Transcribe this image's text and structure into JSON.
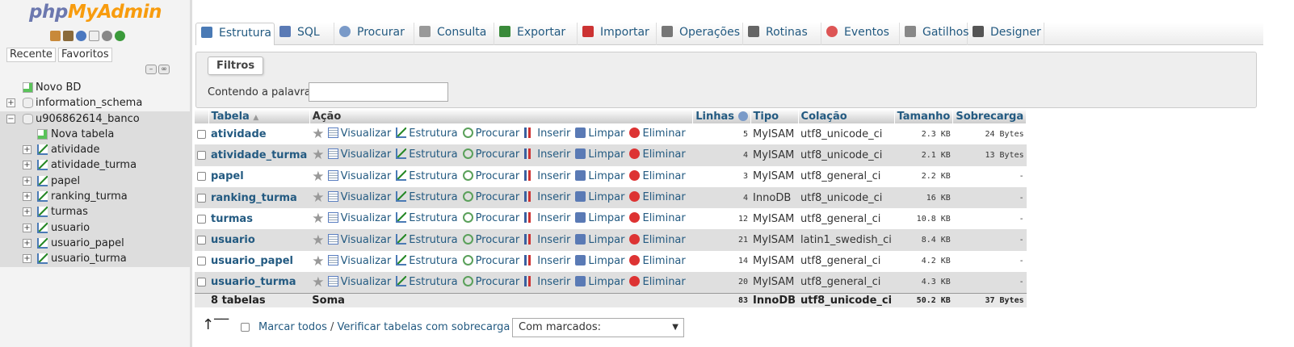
{
  "nav": {
    "logo_php": "php",
    "logo_myadmin": "MyAdmin",
    "icons": [
      "home-icon",
      "logout-icon",
      "help-icon",
      "docs-icon",
      "settings-icon",
      "reload-icon"
    ],
    "tabs": [
      "Recente",
      "Favoritos"
    ],
    "tree": [
      {
        "label": "Novo BD",
        "type": "new-db"
      },
      {
        "label": "information_schema",
        "type": "db"
      },
      {
        "label": "u906862614_banco",
        "type": "db",
        "selected": true
      },
      {
        "label": "Nova tabela",
        "type": "new-table"
      },
      {
        "label": "atividade",
        "type": "table"
      },
      {
        "label": "atividade_turma",
        "type": "table"
      },
      {
        "label": "papel",
        "type": "table"
      },
      {
        "label": "ranking_turma",
        "type": "table"
      },
      {
        "label": "turmas",
        "type": "table"
      },
      {
        "label": "usuario",
        "type": "table"
      },
      {
        "label": "usuario_papel",
        "type": "table"
      },
      {
        "label": "usuario_turma",
        "type": "table"
      }
    ]
  },
  "tabs": [
    "Estrutura",
    "SQL",
    "Procurar",
    "Consulta",
    "Exportar",
    "Importar",
    "Operações",
    "Rotinas",
    "Eventos",
    "Gatilhos",
    "Designer"
  ],
  "filter": {
    "legend": "Filtros",
    "label": "Contendo a palavra:",
    "value": ""
  },
  "table": {
    "headers": {
      "tabela": "Tabela",
      "acao": "Ação",
      "linhas": "Linhas",
      "tipo": "Tipo",
      "colacao": "Colação",
      "tamanho": "Tamanho",
      "sobrecarga": "Sobrecarga"
    },
    "actions": [
      "Visualizar",
      "Estrutura",
      "Procurar",
      "Inserir",
      "Limpar",
      "Eliminar"
    ],
    "rows": [
      {
        "name": "atividade",
        "rows": "5",
        "type": "MyISAM",
        "collation": "utf8_unicode_ci",
        "size": "2.3 KB",
        "overhead": "24 Bytes"
      },
      {
        "name": "atividade_turma",
        "rows": "4",
        "type": "MyISAM",
        "collation": "utf8_unicode_ci",
        "size": "2.1 KB",
        "overhead": "13 Bytes"
      },
      {
        "name": "papel",
        "rows": "3",
        "type": "MyISAM",
        "collation": "utf8_general_ci",
        "size": "2.2 KB",
        "overhead": "-"
      },
      {
        "name": "ranking_turma",
        "rows": "4",
        "type": "InnoDB",
        "collation": "utf8_unicode_ci",
        "size": "16 KB",
        "overhead": "-"
      },
      {
        "name": "turmas",
        "rows": "12",
        "type": "MyISAM",
        "collation": "utf8_general_ci",
        "size": "10.8 KB",
        "overhead": "-"
      },
      {
        "name": "usuario",
        "rows": "21",
        "type": "MyISAM",
        "collation": "latin1_swedish_ci",
        "size": "8.4 KB",
        "overhead": "-"
      },
      {
        "name": "usuario_papel",
        "rows": "14",
        "type": "MyISAM",
        "collation": "utf8_general_ci",
        "size": "4.2 KB",
        "overhead": "-"
      },
      {
        "name": "usuario_turma",
        "rows": "20",
        "type": "MyISAM",
        "collation": "utf8_general_ci",
        "size": "4.3 KB",
        "overhead": "-"
      }
    ],
    "summary": {
      "count": "8 tabelas",
      "label": "Soma",
      "rows": "83",
      "type": "InnoDB",
      "collation": "utf8_unicode_ci",
      "size": "50.2 KB",
      "overhead": "37 Bytes"
    }
  },
  "footer": {
    "check_all": "Marcar todos",
    "separator": " / ",
    "check_overhead": "Verificar tabelas com sobrecarga",
    "with_selected": "Com marcados:"
  }
}
